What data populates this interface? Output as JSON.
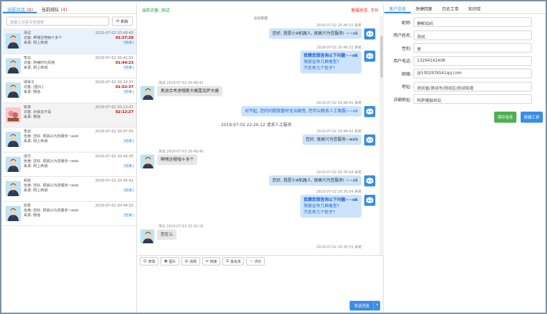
{
  "left": {
    "tabs": [
      {
        "label": "当前对话",
        "count": "(8)"
      },
      {
        "label": "当前排队",
        "count": "(4)"
      }
    ],
    "search_placeholder": "请输入访客名称搜索",
    "refresh_label": "刷新",
    "conversations": [
      {
        "name": "测试",
        "time": "2019-07-02 20:48:45",
        "visit": "访客: 啊嘿达噔咖十多个",
        "timer": "01:37:29",
        "source": "来源: 网上商城",
        "action": "[结束]"
      },
      {
        "name": "李白",
        "time": "2019-07-02 20:41:51",
        "visit": "访客: 阿嘟时代风格",
        "timer": "01:44:23",
        "source": "来源: 网上商城",
        "action": "[结束]"
      },
      {
        "name": "绿荷子",
        "time": "2019-07-02 20:33:37",
        "visit": "访客: [图片]",
        "timer": "01:52:37",
        "source": "来源: 微信",
        "action": "[结束]"
      },
      {
        "name": "铁游",
        "time": "2019-07-02 20:13:47",
        "visit": "访客: 对就这不是",
        "timer": "02:12:27",
        "source": "来源: 微信",
        "action": ""
      },
      {
        "name": "李进",
        "time": "2019-07-02 20:47:55",
        "visit": "坐席: 您好, 很高兴为您服务~web",
        "timer": "",
        "source": "来源: 网上商城",
        "action": "[结束]"
      },
      {
        "name": "成华",
        "time": "2019-07-02 20:46:25",
        "visit": "坐席: 您好, 很高兴为您服务~web",
        "timer": "",
        "source": "来源: 网上商城",
        "action": "[结束]"
      },
      {
        "name": "莉莉",
        "time": "2019-07-02 20:45:42",
        "visit": "坐席: 您好, 很高兴为您服务~web",
        "timer": "",
        "source": "来源: 网上商城",
        "action": "[结束]"
      },
      {
        "name": "张部",
        "time": "2019-07-02 20:44:32",
        "visit": "坐席: 您好, 很高兴为您服务~web",
        "timer": "",
        "source": "来源: 微信",
        "action": "[结束]"
      }
    ]
  },
  "mid": {
    "visitor_label": "当前访客: 测试",
    "status_label": "客服状态: 示忙",
    "no_data": "没有数据",
    "messages": {
      "m1_meta": "2019-07-02 20:48:32 系统",
      "m1_text": "您好, 我是小A机器人, 很高兴为您服务! ~~ok",
      "m2_meta": "2019-07-02 20:48:32 系统",
      "m2_l1": "我猜您想咨询以下问题~~ok",
      "m2_l2": "驾驶证有几种类型?",
      "m2_l3": "汽车有几个轮子?",
      "m3_meta": "测试 2019-07-02 20:48:41",
      "m3_text": "奥迪合考虑哦斯大概露克萨大概",
      "m4_meta": "2019-07-02 20:48:41 系统",
      "m4_text": "对不起, 您的问题我暂时无法解答, 您可以联系人工客服~~ok",
      "sys_line": "2019-07-02 22:26:12 请求人工服务",
      "m5_meta": "2019-07-02 20:48:42 系统",
      "m5_text": "您好, 很高兴为您服务~web",
      "m6_meta": "测试 2019-07-02 20:48:45",
      "m6_text": "啊嘿达噔咖十多个",
      "m7_meta": "2019-07-02 20:35:04 系统",
      "m7_text": "您好, 我是小A机器人, 很高兴为您服务! ~~ok",
      "m8_meta": "2019-07-02 20:35:04 系统",
      "m8_l1": "我猜您想咨询以下问题~~ok",
      "m8_l2": "驾驶证有几种类型?",
      "m8_l3": "汽车有几个轮子?",
      "m9_meta": "李白 2019-07-02 20:35:15",
      "m9_text": "您在么",
      "m10_meta": "2019-07-02 20:35:15 系统"
    },
    "toolbar": [
      "表情",
      "图片",
      "视频",
      "转接",
      "黑名单",
      "评价"
    ],
    "send_label": "发送消息",
    "send_drop": "▾"
  },
  "right": {
    "tabs": [
      "客户信息",
      "快捷回复",
      "历史工单",
      "知识库"
    ],
    "fields": [
      {
        "label": "昵称:",
        "value": "静默如初"
      },
      {
        "label": "用户姓名:",
        "value": "测试"
      },
      {
        "label": "性别:",
        "value": "男"
      },
      {
        "label": "用户电话:",
        "value": "13294142406"
      },
      {
        "label": "邮箱:",
        "value": "@1002978541qq.com"
      },
      {
        "label": "地址:",
        "value": "测试省/测试市/测试区/测试街道"
      },
      {
        "label": "详细地址:",
        "value": "阿萨德伽师瓜"
      }
    ],
    "save_label": "保存信息",
    "new_label": "新建工单"
  }
}
